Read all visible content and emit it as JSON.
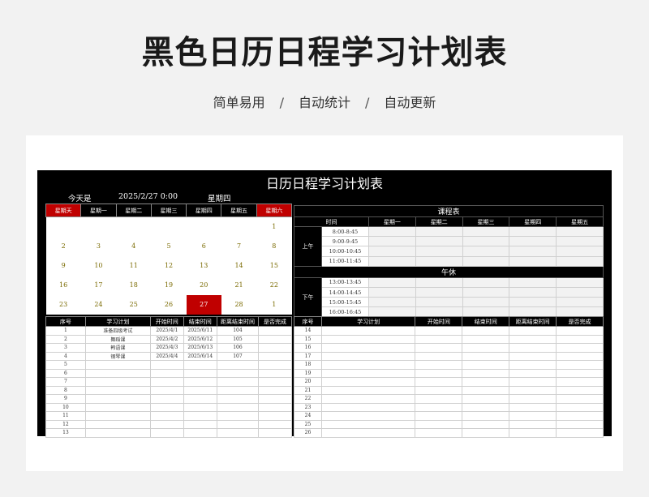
{
  "header": {
    "title": "黑色日历日程学习计划表",
    "tags": [
      "简单易用",
      "自动统计",
      "自动更新"
    ],
    "separator": "/"
  },
  "sheet": {
    "title": "日历日程学习计划表",
    "today_label": "今天是",
    "today_date": "2025/2/27  0:00",
    "today_weekday": "星期四"
  },
  "calendar": {
    "weekdays": [
      "星期天",
      "星期一",
      "星期二",
      "星期三",
      "星期四",
      "星期五",
      "星期六"
    ],
    "weeks": [
      [
        "",
        "",
        "",
        "",
        "",
        "",
        "1"
      ],
      [
        "2",
        "3",
        "4",
        "5",
        "6",
        "7",
        "8"
      ],
      [
        "9",
        "10",
        "11",
        "12",
        "13",
        "14",
        "15"
      ],
      [
        "16",
        "17",
        "18",
        "19",
        "20",
        "21",
        "22"
      ],
      [
        "23",
        "24",
        "25",
        "26",
        "27",
        "28",
        "1"
      ]
    ],
    "highlight_day": "27"
  },
  "schedule": {
    "title": "课程表",
    "columns": [
      "时间",
      "星期一",
      "星期二",
      "星期三",
      "星期四",
      "星期五"
    ],
    "morning_label": "上午",
    "afternoon_label": "下午",
    "lunch_label": "午休",
    "morning_times": [
      "8:00-8:45",
      "9:00-9:45",
      "10:00-10:45",
      "11:00-11:45"
    ],
    "afternoon_times": [
      "13:00-13:45",
      "14:00-14:45",
      "15:00-15:45",
      "16:00-16:45"
    ]
  },
  "plan_left": {
    "columns": [
      "序号",
      "学习计划",
      "开始时间",
      "结束时间",
      "距离结束时间",
      "是否完成"
    ],
    "rows": [
      [
        "1",
        "准备四级考试",
        "2025/4/1",
        "2025/6/11",
        "104",
        ""
      ],
      [
        "2",
        "舞蹈课",
        "2025/4/2",
        "2025/6/12",
        "105",
        ""
      ],
      [
        "3",
        "韩语课",
        "2025/4/3",
        "2025/6/13",
        "106",
        ""
      ],
      [
        "4",
        "钢琴课",
        "2025/4/4",
        "2025/6/14",
        "107",
        ""
      ],
      [
        "5",
        "",
        "",
        "",
        "",
        ""
      ],
      [
        "6",
        "",
        "",
        "",
        "",
        ""
      ],
      [
        "7",
        "",
        "",
        "",
        "",
        ""
      ],
      [
        "8",
        "",
        "",
        "",
        "",
        ""
      ],
      [
        "9",
        "",
        "",
        "",
        "",
        ""
      ],
      [
        "10",
        "",
        "",
        "",
        "",
        ""
      ],
      [
        "11",
        "",
        "",
        "",
        "",
        ""
      ],
      [
        "12",
        "",
        "",
        "",
        "",
        ""
      ],
      [
        "13",
        "",
        "",
        "",
        "",
        ""
      ]
    ]
  },
  "plan_right": {
    "columns": [
      "序号",
      "学习计划",
      "开始时间",
      "结束时间",
      "距离结束时间",
      "是否完成"
    ],
    "rows": [
      [
        "14"
      ],
      [
        "15"
      ],
      [
        "16"
      ],
      [
        "17"
      ],
      [
        "18"
      ],
      [
        "19"
      ],
      [
        "20"
      ],
      [
        "21"
      ],
      [
        "22"
      ],
      [
        "23"
      ],
      [
        "24"
      ],
      [
        "25"
      ],
      [
        "26"
      ]
    ]
  }
}
